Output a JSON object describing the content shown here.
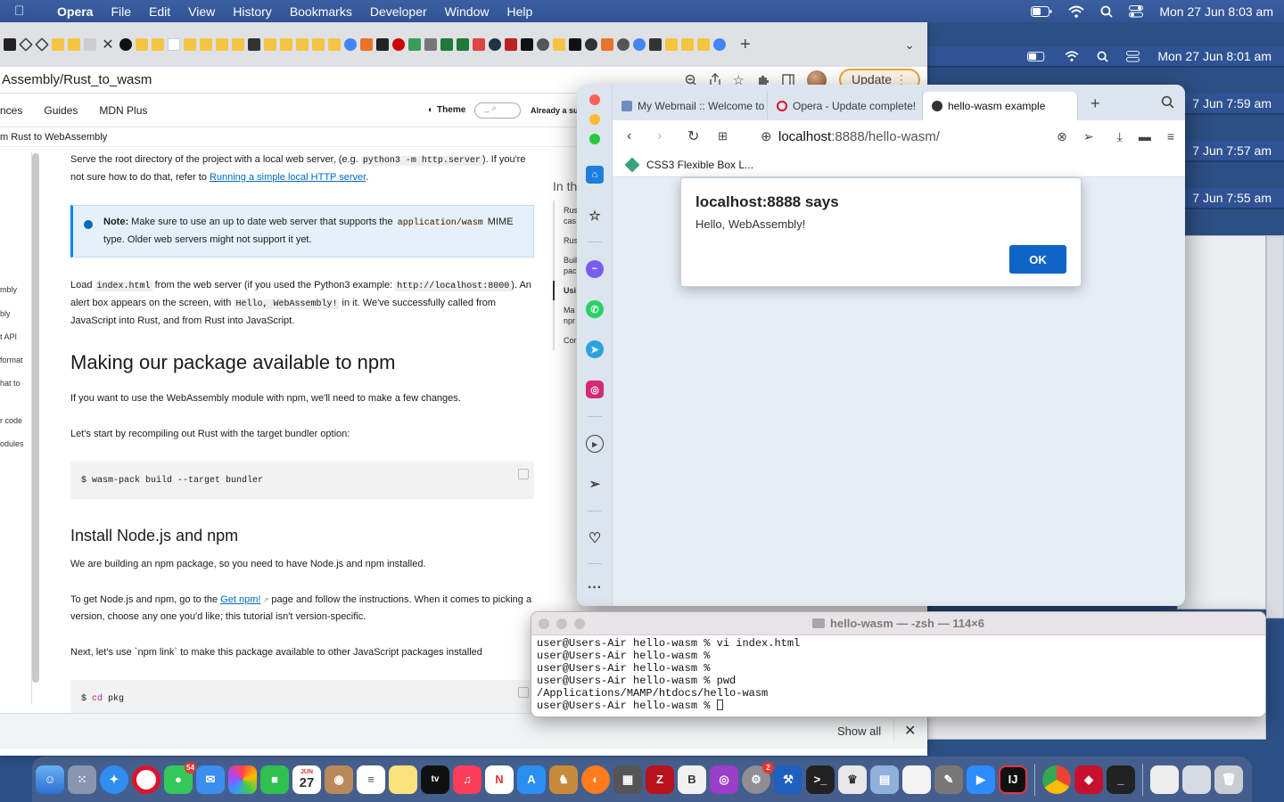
{
  "menubar": {
    "app_name": "Opera",
    "items": [
      "File",
      "Edit",
      "View",
      "History",
      "Bookmarks",
      "Developer",
      "Window",
      "Help"
    ],
    "clock": "Mon 27 Jun  8:03 am"
  },
  "background_clocks": [
    "Mon 27 Jun  8:01 am",
    "7 Jun  7:59 am",
    "7 Jun  7:57 am",
    "7 Jun  7:55 am"
  ],
  "mdn_browser": {
    "url": "Assembly/Rust_to_wasm",
    "update_label": "Update",
    "nav": [
      "nces",
      "Guides",
      "MDN Plus"
    ],
    "theme_label": "Theme",
    "already_label": "Already a su",
    "breadcrumb": "m Rust to WebAssembly",
    "sidebar_items": [
      "mbly",
      "bly",
      "t API",
      "format",
      "hat to",
      "r code",
      "odules"
    ],
    "toc_heading": "In th",
    "toc_items": [
      "Rus cas",
      "Rus",
      "Buil pac",
      "Usi",
      "Ma npr",
      "Cor"
    ],
    "article": {
      "p1_a": "Serve the root directory of the project with a local web server, (e.g. ",
      "p1_code": "python3 -m http.server",
      "p1_b": "). If you're not sure how to do that, refer to ",
      "p1_link": "Running a simple local HTTP server",
      "p1_c": ".",
      "note_label": "Note:",
      "note_a": " Make sure to use an up to date web server that supports the ",
      "note_code": "application/wasm",
      "note_b": " MIME type. Older web servers might not support it yet.",
      "p2_a": "Load ",
      "p2_code1": "index.html",
      "p2_b": " from the web server (if you used the Python3 example: ",
      "p2_code2": "http://localhost:8000",
      "p2_c": "). An alert box appears on the screen, with ",
      "p2_code3": "Hello, WebAssembly!",
      "p2_d": " in it. We've successfully called from JavaScript into Rust, and from Rust into JavaScript.",
      "h2": "Making our package available to npm",
      "p3": "If you want to use the WebAssembly module with npm, we'll need to make a few changes.",
      "p4": "Let's start by recompiling out Rust with the target bundler option:",
      "code1": "$ wasm-pack build --target bundler",
      "h3": "Install Node.js and npm",
      "p5": "We are building an npm package, so you need to have Node.js and npm installed.",
      "p6_a": "To get Node.js and npm, go to the ",
      "p6_link": "Get npm!",
      "p6_b": " page and follow the instructions. When it comes to picking a version, choose any one you'd like; this tutorial isn't version-specific.",
      "p7": "Next, let's use `npm link` to make this package available to other JavaScript packages installed",
      "code2_prompt": "$ ",
      "code2_cmd": "cd",
      "code2_arg": " pkg"
    },
    "download_bar": {
      "show_all": "Show all"
    }
  },
  "opera": {
    "tabs": [
      {
        "label": "My Webmail :: Welcome to M",
        "active": false
      },
      {
        "label": "Opera - Update complete!",
        "active": false
      },
      {
        "label": "hello-wasm example",
        "active": true
      }
    ],
    "url_host": "localhost",
    "url_path": ":8888/hello-wasm/",
    "bookmark": "CSS3 Flexible Box L..."
  },
  "alert": {
    "title": "localhost:8888 says",
    "message": "Hello, WebAssembly!",
    "ok_label": "OK"
  },
  "terminal": {
    "title": "hello-wasm — -zsh — 114×6",
    "lines": [
      "user@Users-Air hello-wasm % vi index.html",
      "user@Users-Air hello-wasm %",
      "user@Users-Air hello-wasm %",
      "user@Users-Air hello-wasm % pwd",
      "/Applications/MAMP/htdocs/hello-wasm",
      "user@Users-Air hello-wasm % "
    ]
  },
  "dock": {
    "calendar_month": "JUN",
    "calendar_day": "27",
    "messages_badge": "54",
    "settings_badge": "2"
  }
}
